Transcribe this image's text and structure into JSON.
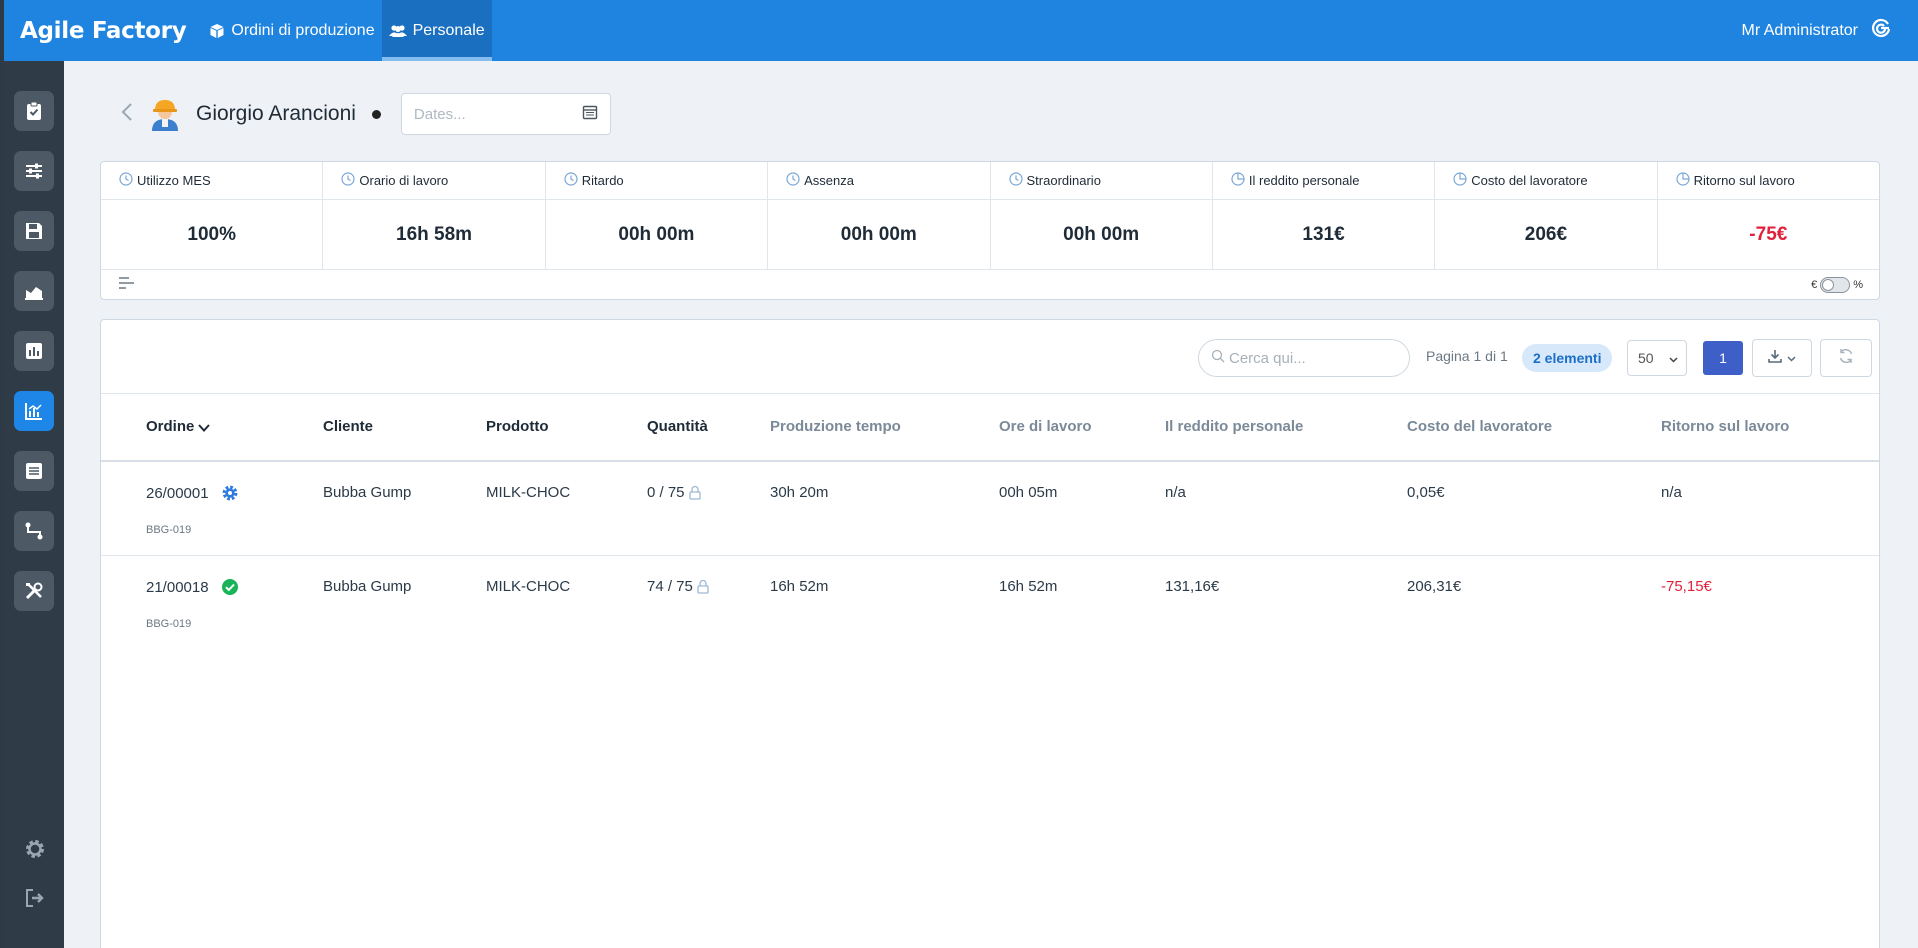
{
  "app": {
    "title": "Agile Factory"
  },
  "nav": {
    "tabs": [
      {
        "label": "Ordini di produzione",
        "icon": "box-icon"
      },
      {
        "label": "Personale",
        "icon": "users-icon",
        "active": true
      }
    ],
    "user": "Mr Administrator"
  },
  "sidebar": {
    "items": [
      {
        "icon": "clipboard-check-icon"
      },
      {
        "icon": "sliders-icon"
      },
      {
        "icon": "save-icon"
      },
      {
        "icon": "area-chart-icon"
      },
      {
        "icon": "bar-chart-icon"
      },
      {
        "icon": "line-chart-icon",
        "active": true
      },
      {
        "icon": "list-icon"
      },
      {
        "icon": "workflow-icon"
      },
      {
        "icon": "tools-icon"
      }
    ],
    "bottom": [
      {
        "icon": "gear-icon"
      },
      {
        "icon": "logout-icon"
      }
    ]
  },
  "header": {
    "name": "Giorgio Arancioni",
    "dates_placeholder": "Dates..."
  },
  "kpis": [
    {
      "label": "Utilizzo MES",
      "value": "100%",
      "icon": "clock-icon"
    },
    {
      "label": "Orario di lavoro",
      "value": "16h 58m",
      "icon": "clock-icon"
    },
    {
      "label": "Ritardo",
      "value": "00h 00m",
      "icon": "clock-icon"
    },
    {
      "label": "Assenza",
      "value": "00h 00m",
      "icon": "clock-icon"
    },
    {
      "label": "Straordinario",
      "value": "00h 00m",
      "icon": "clock-icon"
    },
    {
      "label": "Il reddito personale",
      "value": "131€",
      "icon": "pie-icon"
    },
    {
      "label": "Costo del lavoratore",
      "value": "206€",
      "icon": "pie-icon"
    },
    {
      "label": "Ritorno sul lavoro",
      "value": "-75€",
      "icon": "pie-icon",
      "negative": true
    }
  ],
  "kpi_toggle": {
    "left": "€",
    "right": "%"
  },
  "table": {
    "search_placeholder": "Cerca qui...",
    "page_info": "Pagina 1 di 1",
    "count": "2 elementi",
    "per_page": "50",
    "current_page": "1",
    "columns": [
      "Ordine",
      "Cliente",
      "Prodotto",
      "Quantità",
      "Produzione tempo",
      "Ore di lavoro",
      "Il reddito personale",
      "Costo del lavoratore",
      "Ritorno sul lavoro"
    ],
    "rows": [
      {
        "ordine": "26/00001",
        "code": "BBG-019",
        "status": "in-progress",
        "cliente": "Bubba Gump",
        "prodotto": "MILK-CHOC",
        "quantita": "0 / 75",
        "produzione": "30h 20m",
        "ore": "00h 05m",
        "reddito": "n/a",
        "costo": "0,05€",
        "ritorno": "n/a",
        "ritorno_negative": false
      },
      {
        "ordine": "21/00018",
        "code": "BBG-019",
        "status": "completed",
        "cliente": "Bubba Gump",
        "prodotto": "MILK-CHOC",
        "quantita": "74 / 75",
        "produzione": "16h 52m",
        "ore": "16h 52m",
        "reddito": "131,16€",
        "costo": "206,31€",
        "ritorno": "-75,15€",
        "ritorno_negative": true
      }
    ]
  },
  "colors": {
    "primary": "#1f84e0",
    "sidebar": "#2f3b47",
    "negative": "#e0213b",
    "page_button": "#3e5fc7",
    "success": "#19b35a"
  }
}
